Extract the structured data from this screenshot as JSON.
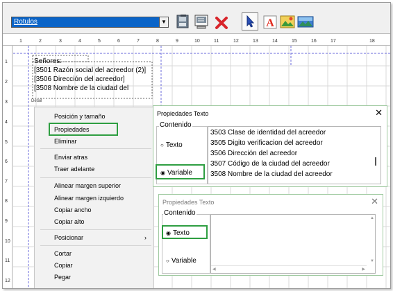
{
  "toolbar": {
    "combo_value": "Rotulos",
    "combo_arrow": "▼",
    "icons": [
      "print-preview-icon",
      "page-setup-icon",
      "delete-icon",
      "select-pointer-icon",
      "text-tool-icon",
      "image-tool-icon",
      "picture-tool-icon"
    ]
  },
  "ruler": {
    "h_ticks": [
      "1",
      "2",
      "3",
      "4",
      "5",
      "6",
      "7",
      "8",
      "9",
      "10",
      "11",
      "12",
      "13",
      "14",
      "15",
      "16",
      "17",
      "18"
    ],
    "v_ticks": [
      "1",
      "2",
      "3",
      "4",
      "5",
      "6",
      "7",
      "8",
      "9",
      "10",
      "11",
      "12"
    ]
  },
  "canvas": {
    "lines": [
      "Señores:",
      "[3501 Razón social del acreedor (2)]",
      "[3506 Dirección del acreedor]",
      "[3508 Nombre de la ciudad del"
    ],
    "section_label": "Detail"
  },
  "context_menu": {
    "items": [
      "Posición y tamaño",
      "Propiedades",
      "Eliminar",
      "Enviar atras",
      "Traer adelante",
      "Alinear margen superior",
      "Alinear margen izquierdo",
      "Copiar ancho",
      "Copiar alto",
      "Posicionar",
      "Cortar",
      "Copiar",
      "Pegar"
    ],
    "submenu_arrow": "›"
  },
  "dialog_variable": {
    "title": "Propiedades Texto",
    "close": "✕",
    "group_label": "Contenido",
    "radio_texto": "Texto",
    "radio_variable": "Variable",
    "list_items": [
      "3503 Clase de identidad del acreedor",
      "3505 Digito verificacion del acreedor",
      "3506 Dirección del acreedor",
      "3507 Código de la ciudad del acreedor",
      "3508 Nombre de la ciudad del acreedor"
    ]
  },
  "dialog_texto": {
    "title": "Propiedades Texto",
    "close": "✕",
    "group_label": "Contenido",
    "radio_texto": "Texto",
    "radio_variable": "Variable",
    "scroll_up": "▲",
    "scroll_down": "▼",
    "scroll_left": "◀",
    "scroll_right": "▶"
  },
  "colors": {
    "highlight": "#2e9e41",
    "selection": "#0a64c8",
    "grid_guide": "#6b6bdb"
  }
}
